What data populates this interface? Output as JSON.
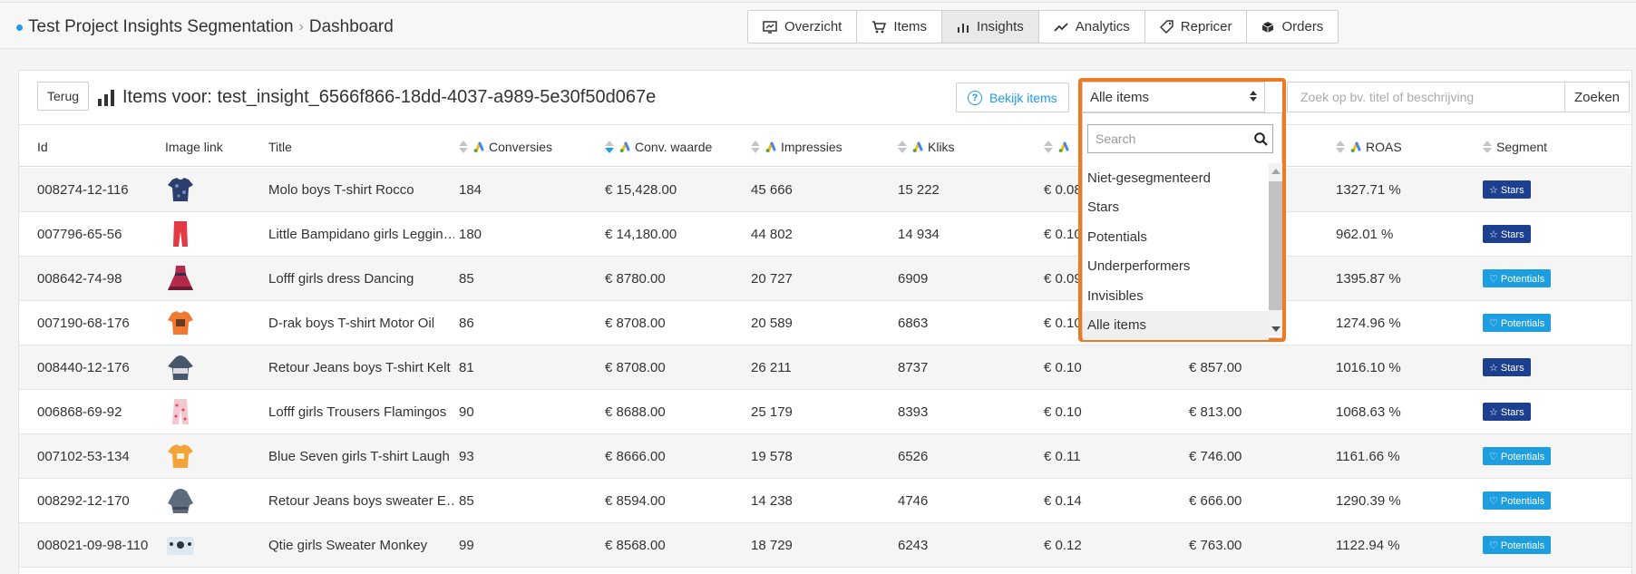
{
  "breadcrumb": {
    "project": "Test Project Insights Segmentation",
    "page": "Dashboard"
  },
  "nav": {
    "tabs": [
      {
        "label": "Overzicht",
        "icon": "overview-icon"
      },
      {
        "label": "Items",
        "icon": "cart-icon"
      },
      {
        "label": "Insights",
        "icon": "bar-chart-icon",
        "active": true
      },
      {
        "label": "Analytics",
        "icon": "trend-line-icon"
      },
      {
        "label": "Repricer",
        "icon": "tag-icon"
      },
      {
        "label": "Orders",
        "icon": "box-icon"
      }
    ]
  },
  "header": {
    "back_label": "Terug",
    "title": "Items voor: test_insight_6566f866-18dd-4037-a989-5e30f50d067e",
    "bekijk_label": "Bekijk items",
    "search_placeholder": "Zoek op bv. titel of beschrijving",
    "search_button": "Zoeken"
  },
  "columns": {
    "id": "Id",
    "image": "Image link",
    "title": "Title",
    "conversies": "Conversies",
    "conv_waarde": "Conv. waarde",
    "impressies": "Impressies",
    "kliks": "Kliks",
    "roas": "ROAS",
    "segment": "Segment"
  },
  "rows": [
    {
      "id": "008274-12-116",
      "image": "navy-tshirt",
      "title": "Molo boys T-shirt Rocco",
      "conversies": "184",
      "conv_waarde": "€ 15,428.00",
      "impressies": "45 666",
      "kliks": "15 222",
      "cpc": "€ 0.08",
      "cost": "",
      "roas": "1327.71 %",
      "segment": "Stars"
    },
    {
      "id": "007796-65-56",
      "image": "red-leggings",
      "title": "Little Bampidano girls Leggin…",
      "conversies": "180",
      "conv_waarde": "€ 14,180.00",
      "impressies": "44 802",
      "kliks": "14 934",
      "cpc": "€ 0.10",
      "cost": "",
      "roas": "962.01 %",
      "segment": "Stars"
    },
    {
      "id": "008642-74-98",
      "image": "dress",
      "title": "Lofff girls dress Dancing",
      "conversies": "85",
      "conv_waarde": "€ 8780.00",
      "impressies": "20 727",
      "kliks": "6909",
      "cpc": "€ 0.09",
      "cost": "",
      "roas": "1395.87 %",
      "segment": "Potentials"
    },
    {
      "id": "007190-68-176",
      "image": "orange-shirt",
      "title": "D-rak boys T-shirt Motor Oil",
      "conversies": "86",
      "conv_waarde": "€ 8708.00",
      "impressies": "20 589",
      "kliks": "6863",
      "cpc": "€ 0.10",
      "cost": "",
      "roas": "1274.96 %",
      "segment": "Potentials"
    },
    {
      "id": "008440-12-176",
      "image": "grey-hoodie",
      "title": "Retour Jeans boys T-shirt Kelt",
      "conversies": "81",
      "conv_waarde": "€ 8708.00",
      "impressies": "26 211",
      "kliks": "8737",
      "cpc": "€ 0.10",
      "cost": "€ 857.00",
      "roas": "1016.10 %",
      "segment": "Stars"
    },
    {
      "id": "006868-69-92",
      "image": "pink-trousers",
      "title": "Lofff girls Trousers Flamingos",
      "conversies": "90",
      "conv_waarde": "€ 8688.00",
      "impressies": "25 179",
      "kliks": "8393",
      "cpc": "€ 0.10",
      "cost": "€ 813.00",
      "roas": "1068.63 %",
      "segment": "Stars"
    },
    {
      "id": "007102-53-134",
      "image": "yellow-tshirt",
      "title": "Blue Seven girls T-shirt Laugh …",
      "conversies": "93",
      "conv_waarde": "€ 8666.00",
      "impressies": "19 578",
      "kliks": "6526",
      "cpc": "€ 0.11",
      "cost": "€ 746.00",
      "roas": "1161.66 %",
      "segment": "Potentials"
    },
    {
      "id": "008292-12-170",
      "image": "grey-sweater",
      "title": "Retour Jeans boys sweater E…",
      "conversies": "85",
      "conv_waarde": "€ 8594.00",
      "impressies": "14 238",
      "kliks": "4746",
      "cpc": "€ 0.14",
      "cost": "€ 666.00",
      "roas": "1290.39 %",
      "segment": "Potentials"
    },
    {
      "id": "008021-09-98-110",
      "image": "white-sweater",
      "title": "Qtie girls Sweater Monkey",
      "conversies": "99",
      "conv_waarde": "€ 8568.00",
      "impressies": "18 729",
      "kliks": "6243",
      "cpc": "€ 0.12",
      "cost": "€ 763.00",
      "roas": "1122.94 %",
      "segment": "Potentials"
    }
  ],
  "dropdown": {
    "selected": "Alle items",
    "search_placeholder": "Search",
    "options": [
      "Niet-gesegmenteerd",
      "Stars",
      "Potentials",
      "Underperformers",
      "Invisibles",
      "Alle items"
    ]
  },
  "colors": {
    "accent": "#1e9be8",
    "highlight": "#ef7a22",
    "stars": "#1d3f8f",
    "potentials": "#1c9ee0"
  }
}
